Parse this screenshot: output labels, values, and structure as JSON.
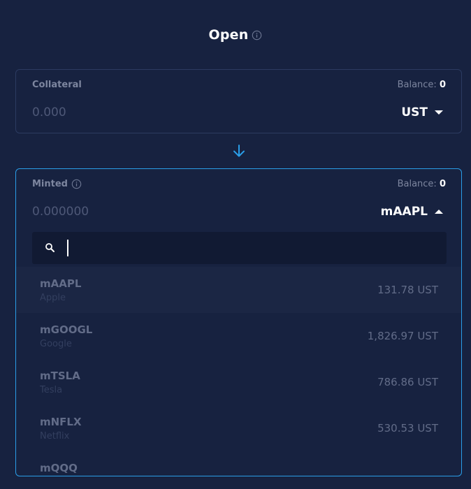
{
  "header": {
    "title": "Open",
    "info_icon": "info-circle-icon"
  },
  "collateral": {
    "label": "Collateral",
    "balance_label": "Balance:",
    "balance_value": "0",
    "amount_placeholder": "0.000",
    "token": "UST",
    "caret_icon": "caret-down-icon"
  },
  "direction_icon": "arrow-down-icon",
  "minted": {
    "label": "Minted",
    "info_icon": "info-circle-icon",
    "balance_label": "Balance:",
    "balance_value": "0",
    "amount_placeholder": "0.000000",
    "token": "mAAPL",
    "caret_icon": "caret-up-icon"
  },
  "dropdown": {
    "search_icon": "search-icon",
    "search_value": "",
    "assets": [
      {
        "symbol": "mAAPL",
        "name": "Apple",
        "price": "131.78 UST"
      },
      {
        "symbol": "mGOOGL",
        "name": "Google",
        "price": "1,826.97 UST"
      },
      {
        "symbol": "mTSLA",
        "name": "Tesla",
        "price": "786.86 UST"
      },
      {
        "symbol": "mNFLX",
        "name": "Netflix",
        "price": "530.53 UST"
      },
      {
        "symbol": "mQQQ",
        "name": "",
        "price": ""
      }
    ]
  },
  "colors": {
    "background": "#172240",
    "accent": "#2a9ee8",
    "card_border": "#2c3b61",
    "muted_text": "#7d869f"
  }
}
